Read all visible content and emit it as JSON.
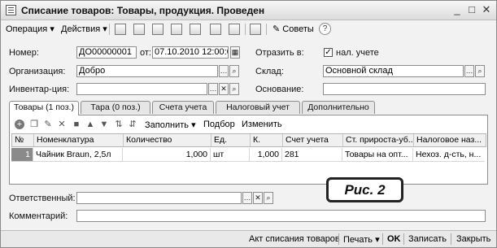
{
  "window": {
    "title": "Списание товаров: Товары, продукция. Проведен",
    "controls": {
      "minimize": "_",
      "maximize": "□",
      "close": "✕"
    }
  },
  "toolbar": {
    "operation": "Операция",
    "actions": "Действия",
    "advice": "Советы",
    "help": "?",
    "dropdown_arrow": "▾"
  },
  "form": {
    "number_label": "Номер:",
    "number_value": "ДО00000001",
    "from_label": "от:",
    "date_value": "07.10.2010 12:00:02",
    "reflect_label": "Отразить в:",
    "tax_checkbox_label": "нал. учете",
    "tax_checked": "✓",
    "org_label": "Организация:",
    "org_value": "Добро",
    "warehouse_label": "Склад:",
    "warehouse_value": "Основной склад",
    "inventory_label": "Инвентар-ция:",
    "inventory_value": "",
    "basis_label": "Основание:",
    "basis_value": ""
  },
  "tabs": [
    {
      "label": "Товары (1 поз.)"
    },
    {
      "label": "Тара (0 поз.)"
    },
    {
      "label": "Счета учета"
    },
    {
      "label": "Налоговый учет"
    },
    {
      "label": "Дополнительно"
    }
  ],
  "table_toolbar": {
    "fill": "Заполнить",
    "selection": "Подбор",
    "change": "Изменить"
  },
  "table": {
    "columns": [
      "№",
      "Номенклатура",
      "Количество",
      "Ед.",
      "К.",
      "Счет учета",
      "Ст. прироста-уб...",
      "Налоговое наз..."
    ],
    "rows": [
      [
        "1",
        "Чайник Braun, 2,5л",
        "1,000",
        "шт",
        "1,000",
        "281",
        "Товары на опт...",
        "Нехоз. д-сть, н..."
      ]
    ]
  },
  "footer_form": {
    "responsible_label": "Ответственный:",
    "responsible_value": "",
    "comment_label": "Комментарий:",
    "comment_value": ""
  },
  "caption": "Рис. 2",
  "bottom_bar": {
    "writeoff_act": "Акт списания товаров",
    "print": "Печать",
    "ok": "OK",
    "save": "Записать",
    "close": "Закрыть"
  }
}
